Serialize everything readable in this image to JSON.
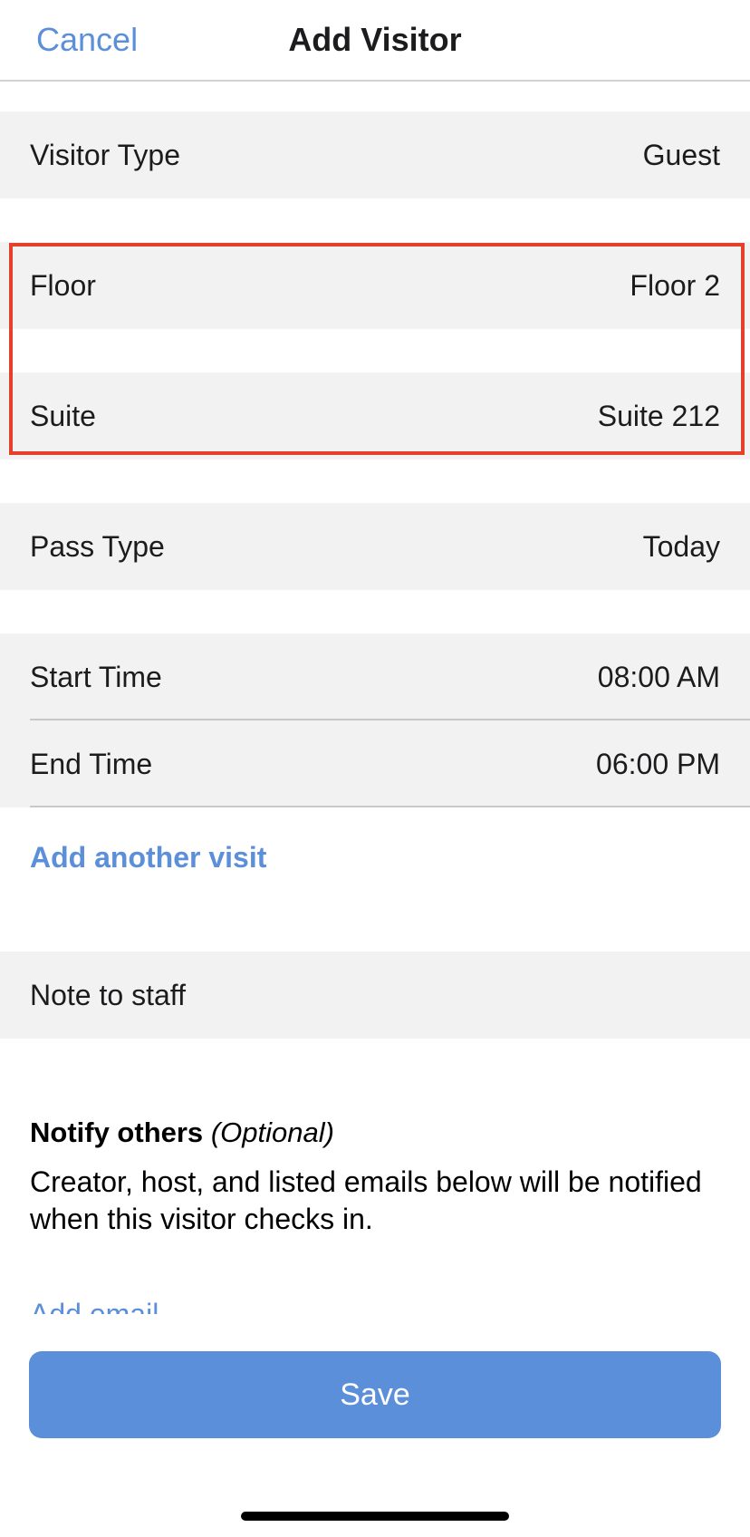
{
  "header": {
    "cancel_label": "Cancel",
    "title": "Add Visitor"
  },
  "form": {
    "visitor_type": {
      "label": "Visitor Type",
      "value": "Guest"
    },
    "floor": {
      "label": "Floor",
      "value": "Floor 2"
    },
    "suite": {
      "label": "Suite",
      "value": "Suite 212"
    },
    "pass_type": {
      "label": "Pass Type",
      "value": "Today"
    },
    "start_time": {
      "label": "Start Time",
      "value": "08:00 AM"
    },
    "end_time": {
      "label": "End Time",
      "value": "06:00 PM"
    },
    "add_visit_label": "Add another visit",
    "note": {
      "label": "Note to staff"
    }
  },
  "notify": {
    "title": "Notify others",
    "optional": "(Optional)",
    "description": "Creator, host, and listed emails below will be notified when this visitor checks in.",
    "add_email_label": "Add email"
  },
  "footer": {
    "save_label": "Save"
  },
  "colors": {
    "accent": "#5b8fd9",
    "highlight": "#e5402b",
    "row_background": "#f2f2f2"
  }
}
